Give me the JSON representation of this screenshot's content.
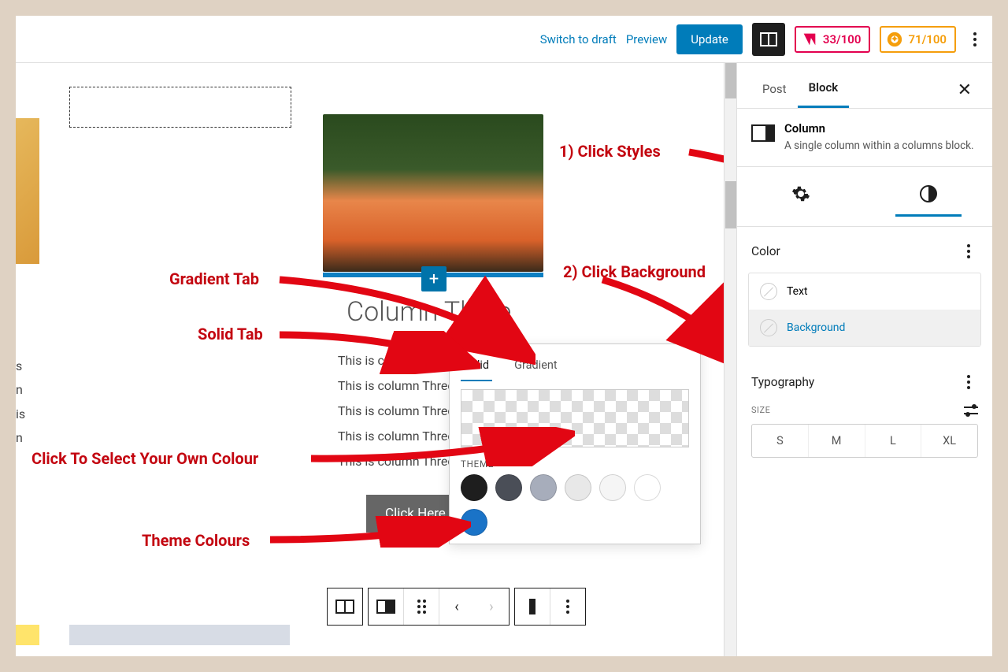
{
  "topbar": {
    "switch_draft": "Switch to draft",
    "preview": "Preview",
    "update": "Update",
    "score_red": "33/100",
    "score_orange": "71/100"
  },
  "sidebar": {
    "tabs": {
      "post": "Post",
      "block": "Block"
    },
    "block_title": "Column",
    "block_desc": "A single column within a columns block.",
    "panel_color": "Color",
    "color_text": "Text",
    "color_background": "Background",
    "panel_typography": "Typography",
    "size_label": "SIZE",
    "sizes": [
      "S",
      "M",
      "L",
      "XL"
    ]
  },
  "canvas": {
    "left_lines": [
      "s",
      "n",
      "is",
      "n"
    ],
    "column_title": "Column Three",
    "column_body": "This is column Three. This is column Three. This is column Three. This is column Three. This is column Three.",
    "click_here": "Click Here"
  },
  "popover": {
    "tab_solid": "Solid",
    "tab_gradient": "Gradient",
    "theme_label": "THEME",
    "theme_colors": [
      "#1e1e1e",
      "#4a4e57",
      "#a7adbb",
      "#e8e8e8",
      "#f5f5f5",
      "#ffffff",
      "#1a73c7"
    ]
  },
  "annotations": {
    "click_styles": "1) Click Styles",
    "click_background": "2) Click Background",
    "gradient_tab": "Gradient Tab",
    "solid_tab": "Solid Tab",
    "own_colour": "Click To Select Your Own Colour",
    "theme_colours": "Theme Colours"
  }
}
